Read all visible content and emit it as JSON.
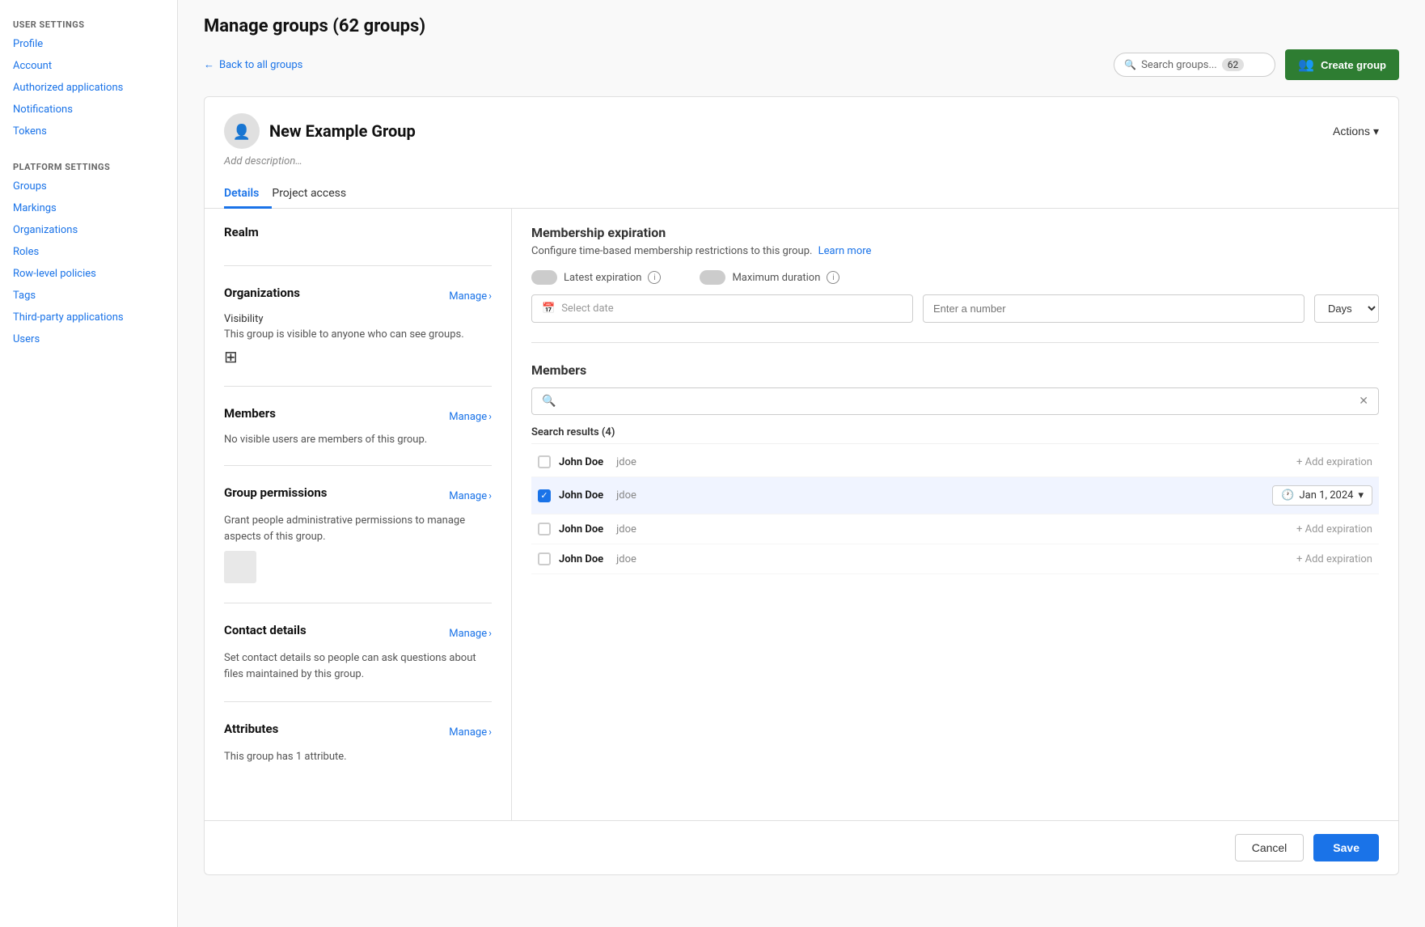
{
  "page": {
    "title": "Manage groups (62 groups)"
  },
  "sidebar": {
    "user_settings_label": "USER SETTINGS",
    "platform_settings_label": "PLATFORM SETTINGS",
    "user_links": [
      {
        "id": "profile",
        "label": "Profile"
      },
      {
        "id": "account",
        "label": "Account"
      },
      {
        "id": "authorized-applications",
        "label": "Authorized applications"
      },
      {
        "id": "notifications",
        "label": "Notifications"
      },
      {
        "id": "tokens",
        "label": "Tokens"
      }
    ],
    "platform_links": [
      {
        "id": "groups",
        "label": "Groups"
      },
      {
        "id": "markings",
        "label": "Markings"
      },
      {
        "id": "organizations",
        "label": "Organizations"
      },
      {
        "id": "roles",
        "label": "Roles"
      },
      {
        "id": "row-level-policies",
        "label": "Row-level policies"
      },
      {
        "id": "tags",
        "label": "Tags"
      },
      {
        "id": "third-party-applications",
        "label": "Third-party applications"
      },
      {
        "id": "users",
        "label": "Users"
      }
    ]
  },
  "topbar": {
    "back_label": "Back to all groups",
    "search_placeholder": "Search groups...",
    "search_count": "62",
    "create_group_label": "Create group"
  },
  "group": {
    "name": "New Example Group",
    "description_placeholder": "Add description…",
    "actions_label": "Actions",
    "tabs": [
      {
        "id": "details",
        "label": "Details",
        "active": true
      },
      {
        "id": "project-access",
        "label": "Project access",
        "active": false
      }
    ]
  },
  "left_col": {
    "realm_section": {
      "title": "Realm"
    },
    "organizations_section": {
      "title": "Organizations",
      "visibility_label": "Visibility",
      "manage_label": "Manage",
      "visibility_text": "This group is visible to anyone who can see groups."
    },
    "members_section": {
      "title": "Members",
      "manage_label": "Manage",
      "no_members_text": "No visible users are members of this group."
    },
    "group_permissions_section": {
      "title": "Group permissions",
      "manage_label": "Manage",
      "desc": "Grant people administrative permissions to manage aspects of this group."
    },
    "contact_details_section": {
      "title": "Contact details",
      "manage_label": "Manage",
      "desc": "Set contact details so people can ask questions about files maintained by this group."
    },
    "attributes_section": {
      "title": "Attributes",
      "manage_label": "Manage",
      "desc": "This group has 1 attribute."
    }
  },
  "right_col": {
    "membership_expiration": {
      "title": "Membership expiration",
      "desc": "Configure time-based membership restrictions to this group.",
      "learn_more_label": "Learn more",
      "latest_expiration_label": "Latest expiration",
      "maximum_duration_label": "Maximum duration",
      "select_date_placeholder": "Select date",
      "enter_number_placeholder": "Enter a number",
      "days_label": "Days"
    },
    "members": {
      "title": "Members",
      "search_placeholder": "",
      "search_results_label": "Search results (4)",
      "rows": [
        {
          "id": 1,
          "name": "John Doe",
          "username": "jdoe",
          "checked": false,
          "expiration": null
        },
        {
          "id": 2,
          "name": "John Doe",
          "username": "jdoe",
          "checked": true,
          "expiration": "Jan 1, 2024"
        },
        {
          "id": 3,
          "name": "John Doe",
          "username": "jdoe",
          "checked": false,
          "expiration": null
        },
        {
          "id": 4,
          "name": "John Doe",
          "username": "jdoe",
          "checked": false,
          "expiration": null
        }
      ],
      "add_expiration_label": "+ Add expiration"
    }
  },
  "footer": {
    "cancel_label": "Cancel",
    "save_label": "Save"
  }
}
